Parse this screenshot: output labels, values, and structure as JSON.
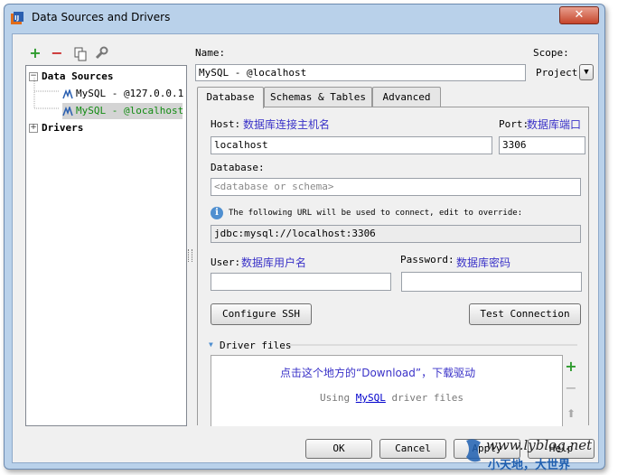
{
  "window": {
    "title": "Data Sources and Drivers",
    "close_glyph": "✕"
  },
  "toolbar": {
    "add_glyph": "+",
    "remove_glyph": "−"
  },
  "tree": {
    "data_sources_label": "Data Sources",
    "items": [
      {
        "label": "MySQL - @127.0.0.1"
      },
      {
        "label": "MySQL - @localhost"
      }
    ],
    "drivers_label": "Drivers",
    "minus_glyph": "−",
    "plus_glyph": "+"
  },
  "form": {
    "name_label": "Name:",
    "name_value": "MySQL - @localhost",
    "scope_label": "Scope:",
    "scope_value": "Project",
    "scope_arrow": "▼"
  },
  "tabs": [
    "Database",
    "Schemas & Tables",
    "Advanced"
  ],
  "database_tab": {
    "host_label": "Host:",
    "host_annotation": "数据库连接主机名",
    "host_value": "localhost",
    "port_label": "Port:",
    "port_annotation": "数据库端口",
    "port_value": "3306",
    "database_label": "Database:",
    "database_placeholder": "<database or schema>",
    "info_glyph": "i",
    "url_hint": "The following URL will be used to connect, edit to override:",
    "url_value": "jdbc:mysql://localhost:3306",
    "user_label": "User:",
    "user_annotation": "数据库用户名",
    "password_label": "Password:",
    "password_annotation": "数据库密码",
    "configure_ssh_label": "Configure SSH",
    "test_connection_label": "Test Connection"
  },
  "driver_files": {
    "toggle_glyph": "▼",
    "label": "Driver files",
    "annotation": "点击这个地方的“Download”，下载驱动",
    "using_prefix": "Using",
    "using_link": "MySQL",
    "using_suffix": "driver files",
    "add_glyph": "+",
    "remove_glyph": "−",
    "up_glyph": "⬆"
  },
  "footer": {
    "ok_label": "OK",
    "cancel_label": "Cancel",
    "apply_label": "Apply",
    "help_label": "Help"
  },
  "watermark": {
    "text": "www.lyblog.net",
    "subtext": "小天地，大世界"
  },
  "colors": {
    "annotation": "#3a32c8",
    "tree_selected_text": "#128b12",
    "add": "#2e9b2e",
    "remove": "#cc2f2f"
  }
}
